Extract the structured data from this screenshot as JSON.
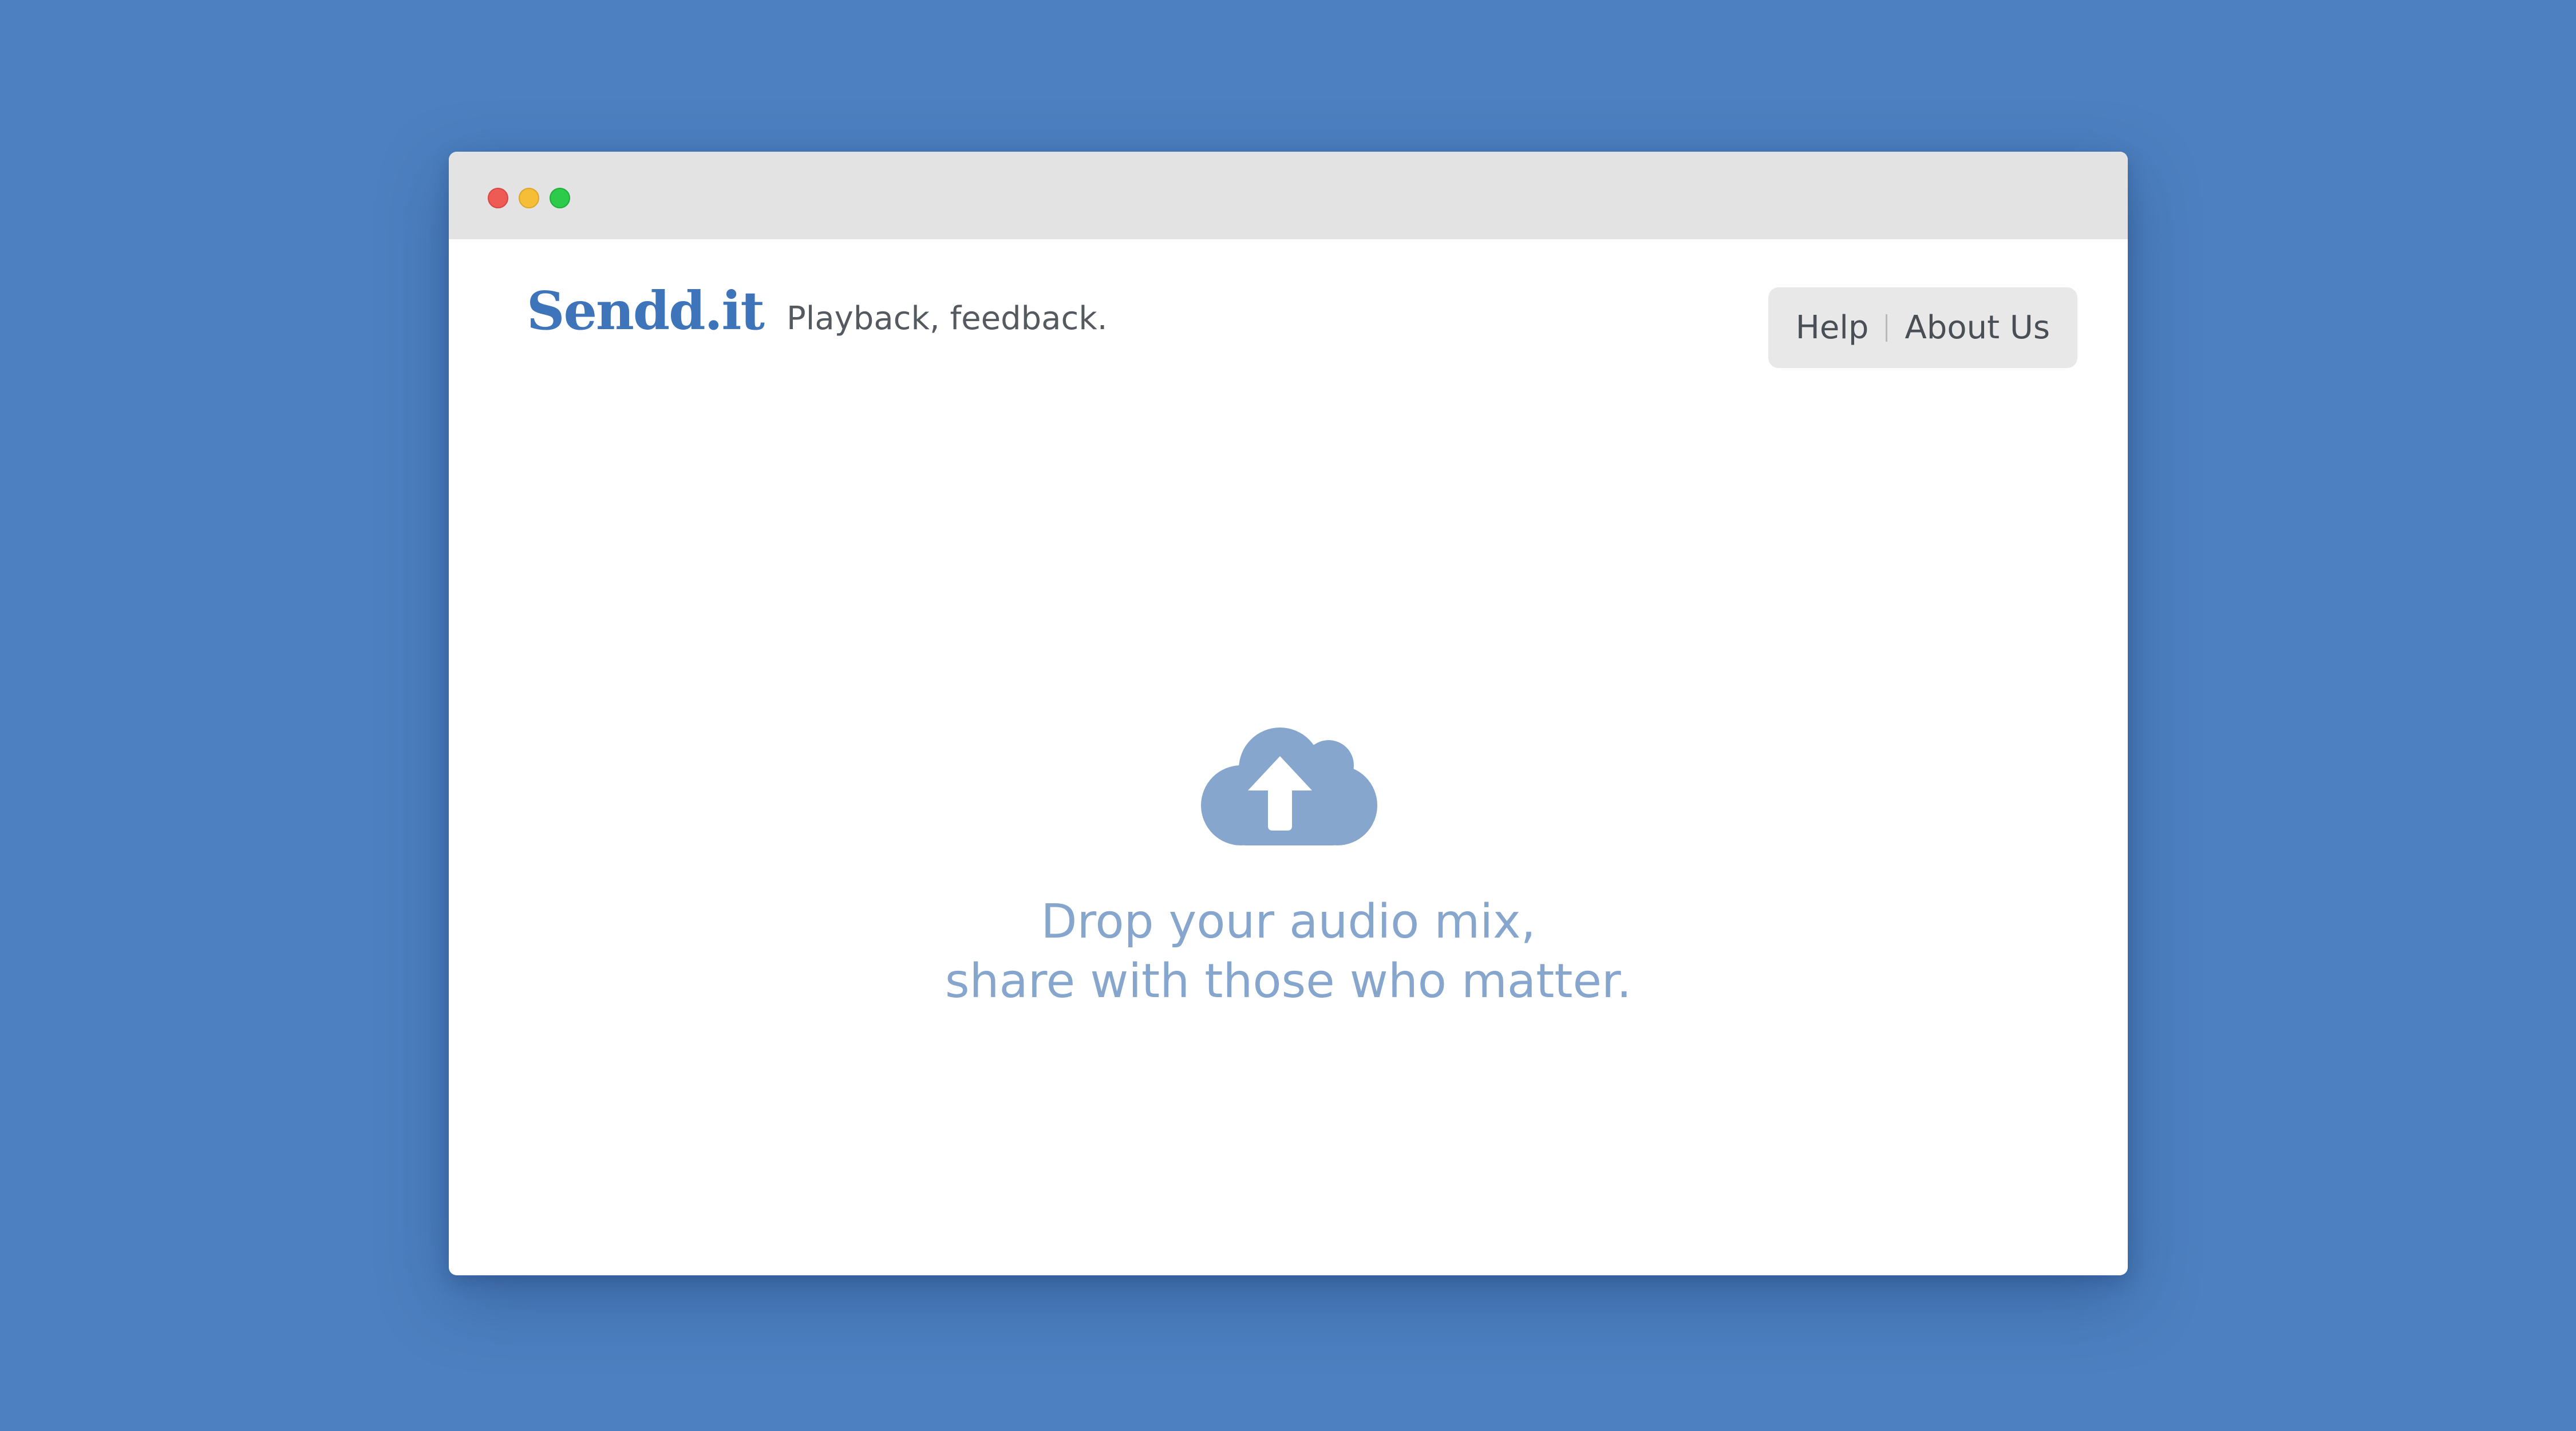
{
  "window": {
    "controls": [
      "close",
      "minimize",
      "maximize"
    ]
  },
  "header": {
    "logo": "Sendd.it",
    "tagline": "Playback, feedback."
  },
  "nav": {
    "help_label": "Help",
    "about_label": "About Us"
  },
  "drop_zone": {
    "icon": "cloud-upload-icon",
    "line1": "Drop your audio mix,",
    "line2": "share with those who matter."
  },
  "colors": {
    "background": "#4d80c0",
    "brand": "#3d74ba",
    "drop_text": "#86a6cd",
    "titlebar": "#e3e3e3"
  }
}
